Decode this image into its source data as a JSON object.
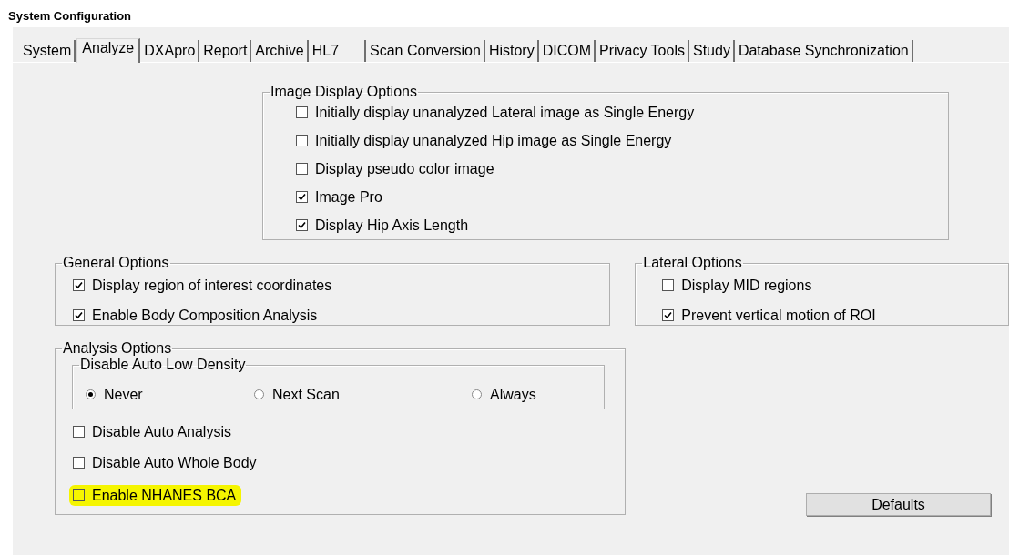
{
  "window": {
    "title": "System Configuration"
  },
  "tabs": [
    {
      "label": "System",
      "selected": false
    },
    {
      "label": "Analyze",
      "selected": true
    },
    {
      "label": "DXApro",
      "selected": false
    },
    {
      "label": "Report",
      "selected": false
    },
    {
      "label": "Archive",
      "selected": false
    },
    {
      "label": "HL7",
      "selected": false
    },
    {
      "label": "Scan Conversion",
      "selected": false
    },
    {
      "label": "History",
      "selected": false
    },
    {
      "label": "DICOM",
      "selected": false
    },
    {
      "label": "Privacy Tools",
      "selected": false
    },
    {
      "label": "Study",
      "selected": false
    },
    {
      "label": "Database Synchronization",
      "selected": false
    }
  ],
  "image_display_options": {
    "title": "Image Display Options",
    "items": [
      {
        "label": "Initially display unanalyzed Lateral image as Single Energy",
        "checked": false
      },
      {
        "label": "Initially display unanalyzed Hip image as Single Energy",
        "checked": false
      },
      {
        "label": "Display pseudo color image",
        "checked": false
      },
      {
        "label": "Image Pro",
        "checked": true
      },
      {
        "label": "Display Hip Axis Length",
        "checked": true
      }
    ]
  },
  "general_options": {
    "title": "General Options",
    "items": [
      {
        "label": "Display region of interest coordinates",
        "checked": true
      },
      {
        "label": "Enable Body Composition Analysis",
        "checked": true
      }
    ]
  },
  "lateral_options": {
    "title": "Lateral Options",
    "items": [
      {
        "label": "Display MID regions",
        "checked": false
      },
      {
        "label": "Prevent vertical motion of ROI",
        "checked": true
      }
    ]
  },
  "analysis_options": {
    "title": "Analysis Options",
    "items": [
      {
        "kind": "radio_group",
        "title": "Disable Auto Low Density",
        "options": [
          {
            "label": "Never",
            "selected": true
          },
          {
            "label": "Next Scan",
            "selected": false
          },
          {
            "label": "Always",
            "selected": false
          }
        ]
      },
      {
        "kind": "checkbox",
        "label": "Disable Auto Analysis",
        "checked": false,
        "highlighted": false
      },
      {
        "kind": "checkbox",
        "label": "Disable Auto Whole Body",
        "checked": false,
        "highlighted": false
      },
      {
        "kind": "checkbox",
        "label": "Enable NHANES BCA",
        "checked": false,
        "highlighted": true
      }
    ]
  },
  "buttons": [
    "Defaults"
  ]
}
